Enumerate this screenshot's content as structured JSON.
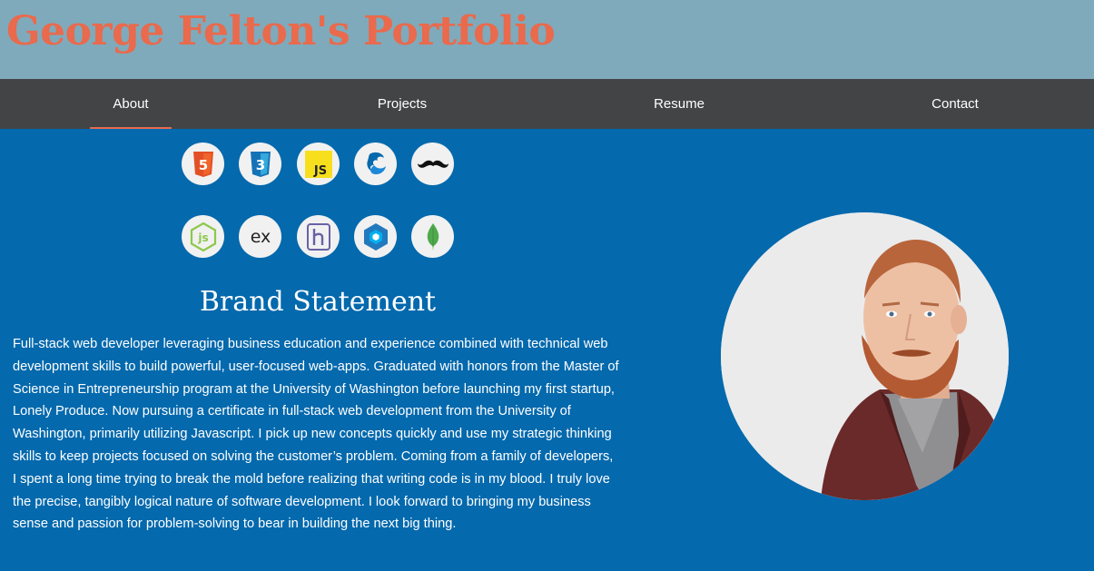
{
  "header": {
    "title": "George Felton's Portfolio",
    "title_color": "#e96a4c",
    "background": "#7faabb"
  },
  "nav": {
    "items": [
      {
        "label": "About",
        "active": true
      },
      {
        "label": "Projects",
        "active": false
      },
      {
        "label": "Resume",
        "active": false
      },
      {
        "label": "Contact",
        "active": false
      }
    ]
  },
  "tech_icons": [
    {
      "name": "html5-icon",
      "color": "#e34f26"
    },
    {
      "name": "css3-icon",
      "color": "#1572b6"
    },
    {
      "name": "javascript-icon",
      "color": "#f7df1e",
      "text": "JS"
    },
    {
      "name": "jquery-icon",
      "color": "#0769ad"
    },
    {
      "name": "handlebars-icon",
      "color": "#000000"
    },
    {
      "name": "nodejs-icon",
      "color": "#8cc84b",
      "text": "js"
    },
    {
      "name": "express-icon",
      "color": "#222222",
      "text": "ex"
    },
    {
      "name": "heroku-icon",
      "color": "#6762a6"
    },
    {
      "name": "sequelize-icon",
      "color": "#2379bd"
    },
    {
      "name": "mongodb-icon",
      "color": "#4fa94d"
    }
  ],
  "about": {
    "heading": "Brand Statement",
    "statement": "Full-stack web developer leveraging business education and experience combined with technical web development skills to build powerful, user-focused web-apps. Graduated with honors from the Master of Science in Entrepreneurship program at the University of Washington before launching my first startup, Lonely Produce. Now pursuing a certificate in full-stack web development from the University of Washington, primarily utilizing Javascript. I pick up new concepts quickly and use my strategic thinking skills to keep projects focused on solving the customer’s problem. Coming from a family of developers, I spent a long time trying to break the mold before realizing that writing code is in my blood. I truly love the precise, tangibly logical nature of software development. I look forward to bringing my business sense and passion for problem-solving to bear in building the next big thing."
  },
  "colors": {
    "page_background": "#0469ad",
    "nav_background": "#424446",
    "accent": "#e96a4c"
  }
}
